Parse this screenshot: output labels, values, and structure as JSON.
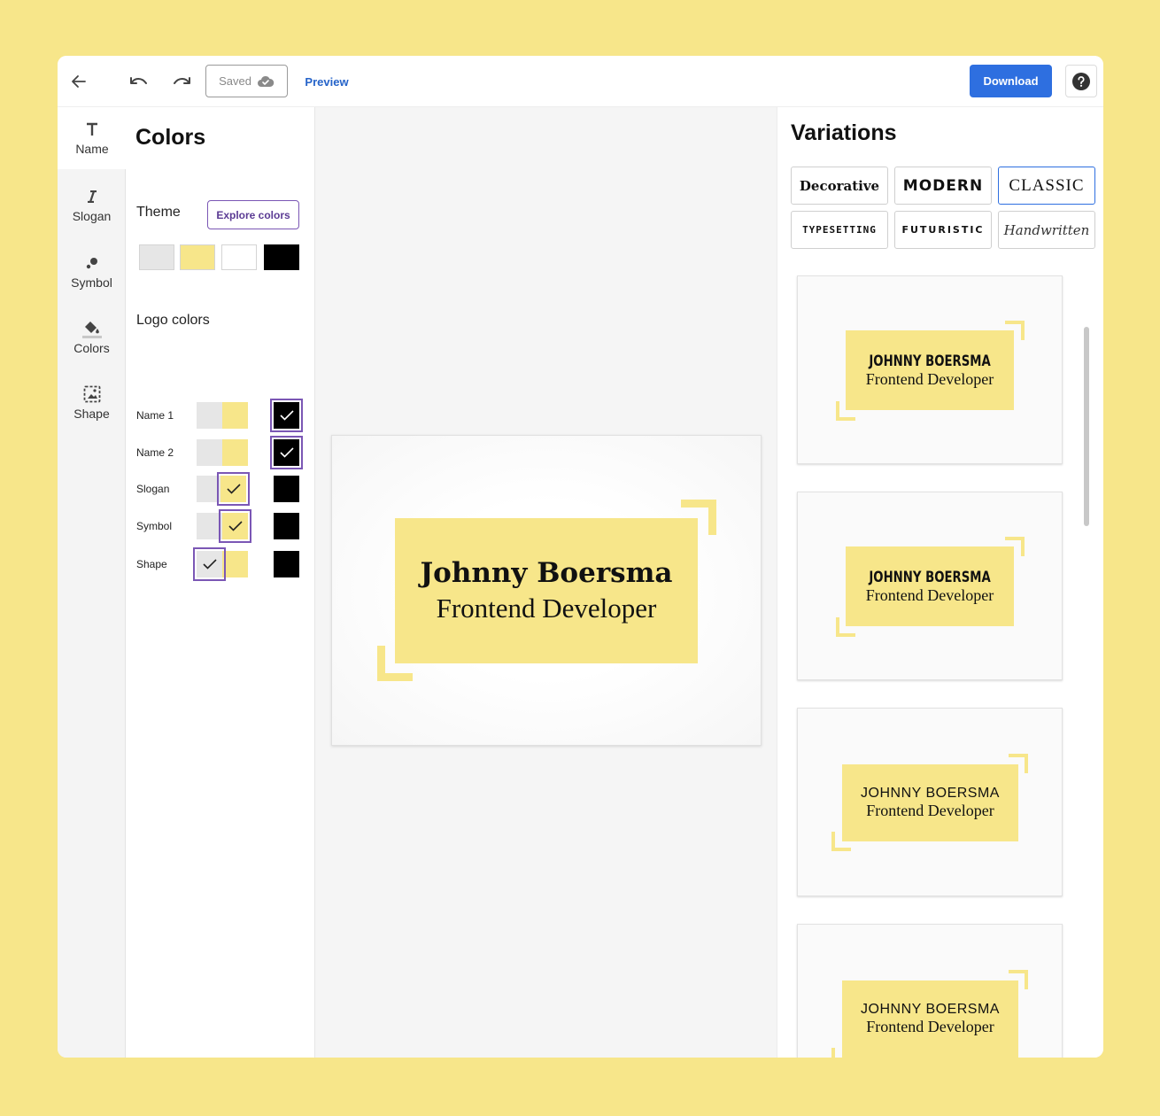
{
  "toolbar": {
    "saved_label": "Saved",
    "preview_label": "Preview",
    "download_label": "Download"
  },
  "nav": {
    "items": [
      {
        "label": "Name",
        "icon": "text-icon"
      },
      {
        "label": "Slogan",
        "icon": "italic-icon"
      },
      {
        "label": "Symbol",
        "icon": "symbol-icon"
      },
      {
        "label": "Colors",
        "icon": "paint-bucket-icon"
      },
      {
        "label": "Shape",
        "icon": "shape-icon"
      }
    ],
    "active": "Colors"
  },
  "panel": {
    "title": "Colors",
    "theme_label": "Theme",
    "explore_label": "Explore colors",
    "theme_colors": [
      "#e6e6e6",
      "#f7e68a",
      "#ffffff",
      "#000000"
    ],
    "logo_colors_label": "Logo colors",
    "rows": [
      {
        "label": "Name 1",
        "selected": "#000000"
      },
      {
        "label": "Name 2",
        "selected": "#000000"
      },
      {
        "label": "Slogan",
        "selected": "#f7e68a"
      },
      {
        "label": "Symbol",
        "selected": "#f7e68a"
      },
      {
        "label": "Shape",
        "selected": "#e6e6e6"
      }
    ]
  },
  "preview": {
    "name": "Johnny Boersma",
    "slogan": "Frontend Developer"
  },
  "variations": {
    "title": "Variations",
    "fonts": [
      {
        "label": "Decorative",
        "selected": false
      },
      {
        "label": "MODERN",
        "selected": false
      },
      {
        "label": "CLASSIC",
        "selected": true
      },
      {
        "label": "TYPESETTING",
        "selected": false
      },
      {
        "label": "FUTURISTIC",
        "selected": false
      },
      {
        "label": "Handwritten",
        "selected": false
      }
    ],
    "cards": [
      {
        "name": "JOHNNY BOERSMA",
        "slogan": "Frontend Developer"
      },
      {
        "name": "JOHNNY BOERSMA",
        "slogan": "Frontend Developer"
      },
      {
        "name": "JOHNNY BOERSMA",
        "slogan": "Frontend Developer"
      },
      {
        "name": "JOHNNY BOERSMA",
        "slogan": "Frontend Developer"
      }
    ]
  },
  "colors": {
    "accent": "#2e6fe0",
    "purple": "#7b57b5",
    "brand_yellow": "#f7e68a"
  }
}
